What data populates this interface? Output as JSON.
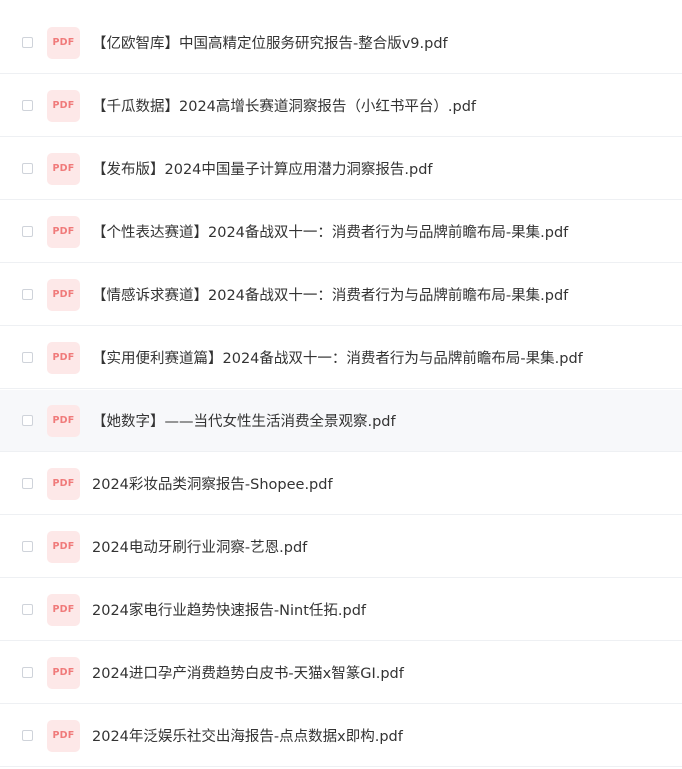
{
  "icon_label": "PDF",
  "colors": {
    "icon_bg": "#fde8e8",
    "icon_text": "#f07a7a",
    "text": "#333333",
    "divider": "#eef0f3",
    "hover_bg": "#f7f8fa"
  },
  "files": [
    {
      "name": "【亿欧智库】中国高精定位服务研究报告-整合版v9.pdf"
    },
    {
      "name": "【千瓜数据】2024高增长赛道洞察报告（小红书平台）.pdf"
    },
    {
      "name": "【发布版】2024中国量子计算应用潜力洞察报告.pdf"
    },
    {
      "name": "【个性表达赛道】2024备战双十一：消费者行为与品牌前瞻布局-果集.pdf"
    },
    {
      "name": "【情感诉求赛道】2024备战双十一：消费者行为与品牌前瞻布局-果集.pdf"
    },
    {
      "name": "【实用便利赛道篇】2024备战双十一：消费者行为与品牌前瞻布局-果集.pdf"
    },
    {
      "name": "【她数字】——当代女性生活消费全景观察.pdf"
    },
    {
      "name": "2024彩妆品类洞察报告-Shopee.pdf"
    },
    {
      "name": "2024电动牙刷行业洞察-艺恩.pdf"
    },
    {
      "name": "2024家电行业趋势快速报告-Nint任拓.pdf"
    },
    {
      "name": "2024进口孕产消费趋势白皮书-天猫x智篆GI.pdf"
    },
    {
      "name": "2024年泛娱乐社交出海报告-点点数据x即构.pdf"
    }
  ]
}
